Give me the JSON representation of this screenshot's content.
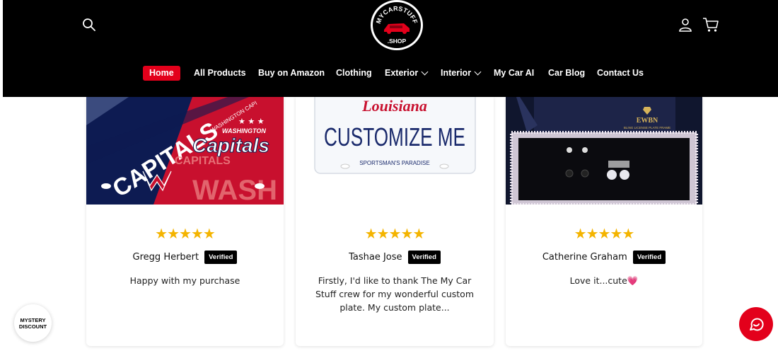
{
  "header": {
    "logo_top_text": "MYCARSTUFF",
    "logo_bottom_text": ".SHOP",
    "icons": {
      "search": "search-icon",
      "account": "user-icon",
      "cart": "cart-icon"
    }
  },
  "nav": {
    "items": [
      {
        "label": "Home",
        "active": true
      },
      {
        "label": "All Products"
      },
      {
        "label": "Buy on Amazon"
      },
      {
        "label": "Clothing"
      },
      {
        "label": "Exterior",
        "dropdown": true
      },
      {
        "label": "Interior",
        "dropdown": true
      },
      {
        "label": "My Car AI"
      },
      {
        "label": "Car Blog"
      },
      {
        "label": "Contact Us"
      }
    ]
  },
  "reviews": [
    {
      "rating": 5,
      "stars": "★★★★★",
      "name": "Gregg Herbert",
      "badge": "Verified",
      "text": "Happy with my purchase",
      "image": {
        "title": "CAPITALS",
        "team_small": "WASHINGTON",
        "logo_word": "Capitals",
        "bottom_big": "WASH",
        "bottom_word": "CAPITALS",
        "side_small": "WASHINGTON CAPI"
      }
    },
    {
      "rating": 5,
      "stars": "★★★★★",
      "name": "Tashae Jose",
      "badge": "Verified",
      "text": "Firstly, I'd like to thank The My Car Stuff crew for my wonderful custom plate. My custom plate...",
      "image": {
        "state": "Louisiana",
        "main": "CUSTOMIZE ME",
        "footer": "SPORTSMAN'S PARADISE"
      }
    },
    {
      "rating": 5,
      "stars": "★★★★★",
      "name": "Catherine Graham",
      "badge": "Verified",
      "text": "Love it...cute💗",
      "image": {
        "brand": "EWBN",
        "tagline": "BLING LICENSE PLATE FRAME"
      }
    }
  ],
  "floating": {
    "mystery_line1": "MYSTERY",
    "mystery_line2": "DISCOUNT"
  },
  "colors": {
    "accent": "#e3001b",
    "star": "#f4b400",
    "header_bg": "#000000"
  }
}
